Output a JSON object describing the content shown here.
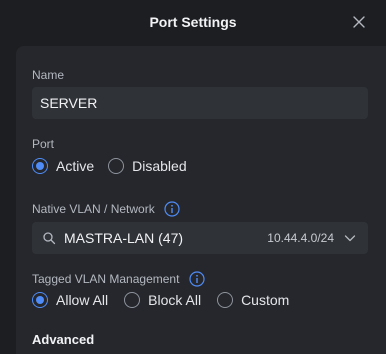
{
  "dialog": {
    "title": "Port Settings",
    "close_icon": "close-icon"
  },
  "name": {
    "label": "Name",
    "value": "SERVER"
  },
  "port": {
    "label": "Port",
    "options": [
      {
        "label": "Active",
        "selected": true
      },
      {
        "label": "Disabled",
        "selected": false
      }
    ]
  },
  "native_vlan": {
    "label": "Native VLAN / Network",
    "info_icon": "info-icon",
    "search_icon": "search-icon",
    "selected": "MASTRA-LAN (47)",
    "subnet": "10.44.4.0/24",
    "chevron_icon": "chevron-down-icon"
  },
  "tagged_vlan": {
    "label": "Tagged VLAN Management",
    "info_icon": "info-icon",
    "options": [
      {
        "label": "Allow All",
        "selected": true
      },
      {
        "label": "Block All",
        "selected": false
      },
      {
        "label": "Custom",
        "selected": false
      }
    ]
  },
  "advanced": {
    "label": "Advanced"
  },
  "colors": {
    "accent": "#4f8cf7",
    "background": "#1c1e22",
    "panel": "#25272c",
    "field": "#2f3237"
  }
}
